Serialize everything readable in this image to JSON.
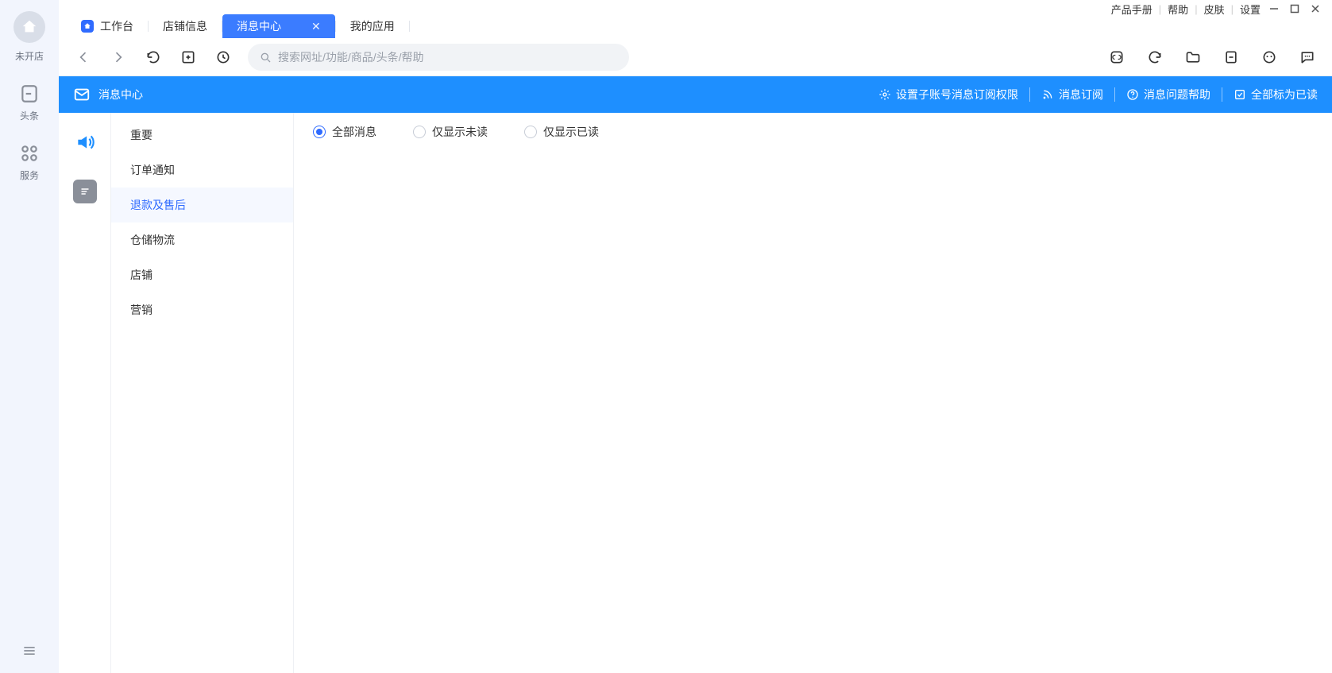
{
  "leftRail": {
    "status": "未开店",
    "items": [
      {
        "label": "头条"
      },
      {
        "label": "服务"
      }
    ]
  },
  "topMenu": {
    "links": [
      "产品手册",
      "帮助",
      "皮肤",
      "设置"
    ]
  },
  "tabs": [
    {
      "label": "工作台",
      "home": true
    },
    {
      "label": "店铺信息"
    },
    {
      "label": "消息中心",
      "active": true,
      "closable": true
    },
    {
      "label": "我的应用"
    }
  ],
  "search": {
    "placeholder": "搜索网址/功能/商品/头条/帮助"
  },
  "blueBar": {
    "title": "消息中心",
    "actions": [
      {
        "label": "设置子账号消息订阅权限",
        "icon": "gear"
      },
      {
        "label": "消息订阅",
        "icon": "rss"
      },
      {
        "label": "消息问题帮助",
        "icon": "help"
      },
      {
        "label": "全部标为已读",
        "icon": "check"
      }
    ]
  },
  "categories": [
    {
      "label": "重要"
    },
    {
      "label": "订单通知"
    },
    {
      "label": "退款及售后",
      "active": true
    },
    {
      "label": "仓储物流"
    },
    {
      "label": "店铺"
    },
    {
      "label": "营销"
    }
  ],
  "filters": [
    {
      "label": "全部消息",
      "checked": true
    },
    {
      "label": "仅显示未读"
    },
    {
      "label": "仅显示已读"
    }
  ]
}
